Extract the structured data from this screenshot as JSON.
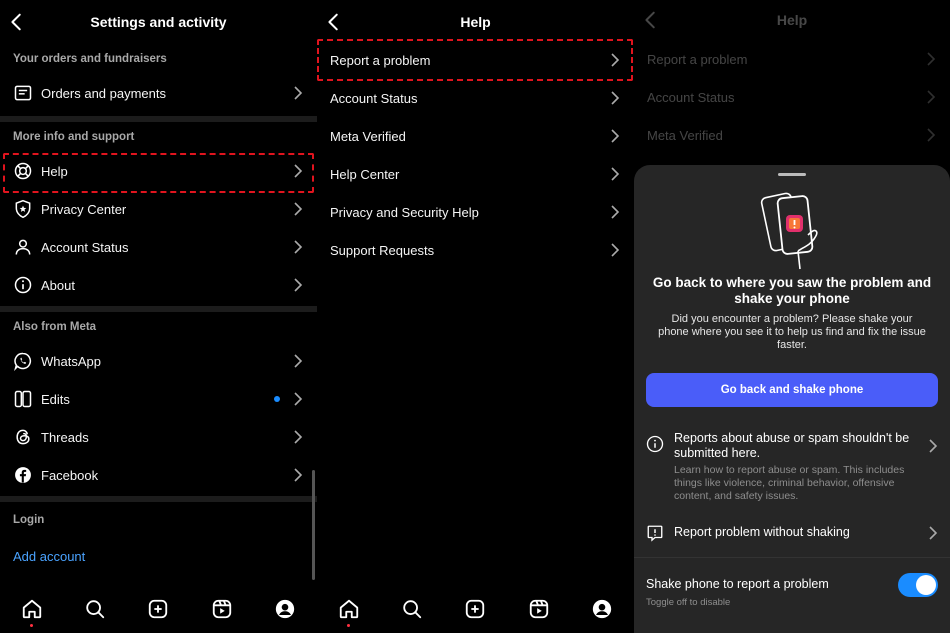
{
  "settings": {
    "title": "Settings and activity",
    "sections": {
      "orders_header": "Your orders and fundraisers",
      "orders_item": "Orders and payments",
      "support_header": "More info and support",
      "support_items": [
        "Help",
        "Privacy Center",
        "Account Status",
        "About"
      ],
      "meta_header": "Also from Meta",
      "meta_items": [
        "WhatsApp",
        "Edits",
        "Threads",
        "Facebook"
      ],
      "login_header": "Login",
      "add_account": "Add account"
    }
  },
  "help": {
    "title": "Help",
    "items": [
      "Report a problem",
      "Account Status",
      "Meta Verified",
      "Help Center",
      "Privacy and Security Help",
      "Support Requests"
    ]
  },
  "sheet": {
    "title": "Go back to where you saw the problem and shake your phone",
    "description": "Did you encounter a problem? Please shake your phone where you see it to help us find and fix the issue faster.",
    "cta": "Go back and shake phone",
    "abuse_title": "Reports about abuse or spam shouldn't be submitted here.",
    "abuse_desc": "Learn how to report abuse or spam. This includes things like violence, criminal behavior, offensive content, and safety issues.",
    "report_without_shaking": "Report problem without shaking",
    "shake_label": "Shake phone to report a problem",
    "shake_sub": "Toggle off to disable",
    "shake_enabled": true
  },
  "colors": {
    "accent_button": "#4a5df9",
    "toggle_on": "#1a8cff",
    "highlight": "#e0141e",
    "link": "#4aa3ff"
  }
}
